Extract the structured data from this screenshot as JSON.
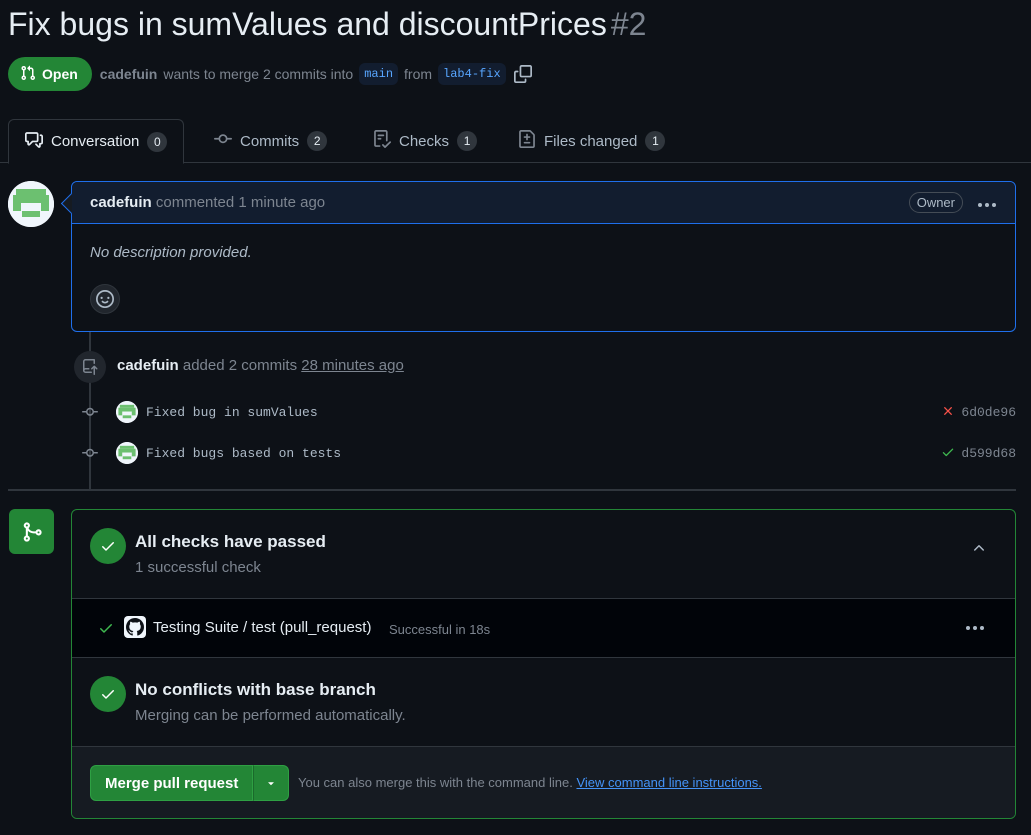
{
  "pr": {
    "title": "Fix bugs in sumValues and discountPrices",
    "number": "#2",
    "state": "Open",
    "author": "cadefuin",
    "merge_text_pre": "wants to merge 2 commits into",
    "base_branch": "main",
    "from_text": "from",
    "head_branch": "lab4-fix"
  },
  "tabs": [
    {
      "label": "Conversation",
      "count": "0",
      "icon": "comment-discussion-icon"
    },
    {
      "label": "Commits",
      "count": "2",
      "icon": "git-commit-icon"
    },
    {
      "label": "Checks",
      "count": "1",
      "icon": "checklist-icon"
    },
    {
      "label": "Files changed",
      "count": "1",
      "icon": "file-diff-icon"
    }
  ],
  "comment": {
    "author": "cadefuin",
    "action": "commented 1 minute ago",
    "badge": "Owner",
    "body": "No description provided."
  },
  "timeline": {
    "author": "cadefuin",
    "action": "added 2 commits",
    "time": "28 minutes ago",
    "commits": [
      {
        "message": "Fixed bug in sumValues",
        "sha": "6d0de96",
        "status": "failure",
        "status_color": "#f85149"
      },
      {
        "message": "Fixed bugs based on tests",
        "sha": "d599d68",
        "status": "success",
        "status_color": "#3fb950"
      }
    ]
  },
  "merge_box": {
    "checks_title": "All checks have passed",
    "checks_subtitle": "1 successful check",
    "check_name": "Testing Suite / test (pull_request)",
    "check_status": "Successful in 18s",
    "conflicts_title": "No conflicts with base branch",
    "conflicts_subtitle": "Merging can be performed automatically.",
    "merge_button": "Merge pull request",
    "cli_text": "You can also merge this with the command line.",
    "cli_link": "View command line instructions."
  },
  "colors": {
    "accent_green": "#238636",
    "accent_blue": "#1f6feb",
    "background": "#0d1117"
  }
}
